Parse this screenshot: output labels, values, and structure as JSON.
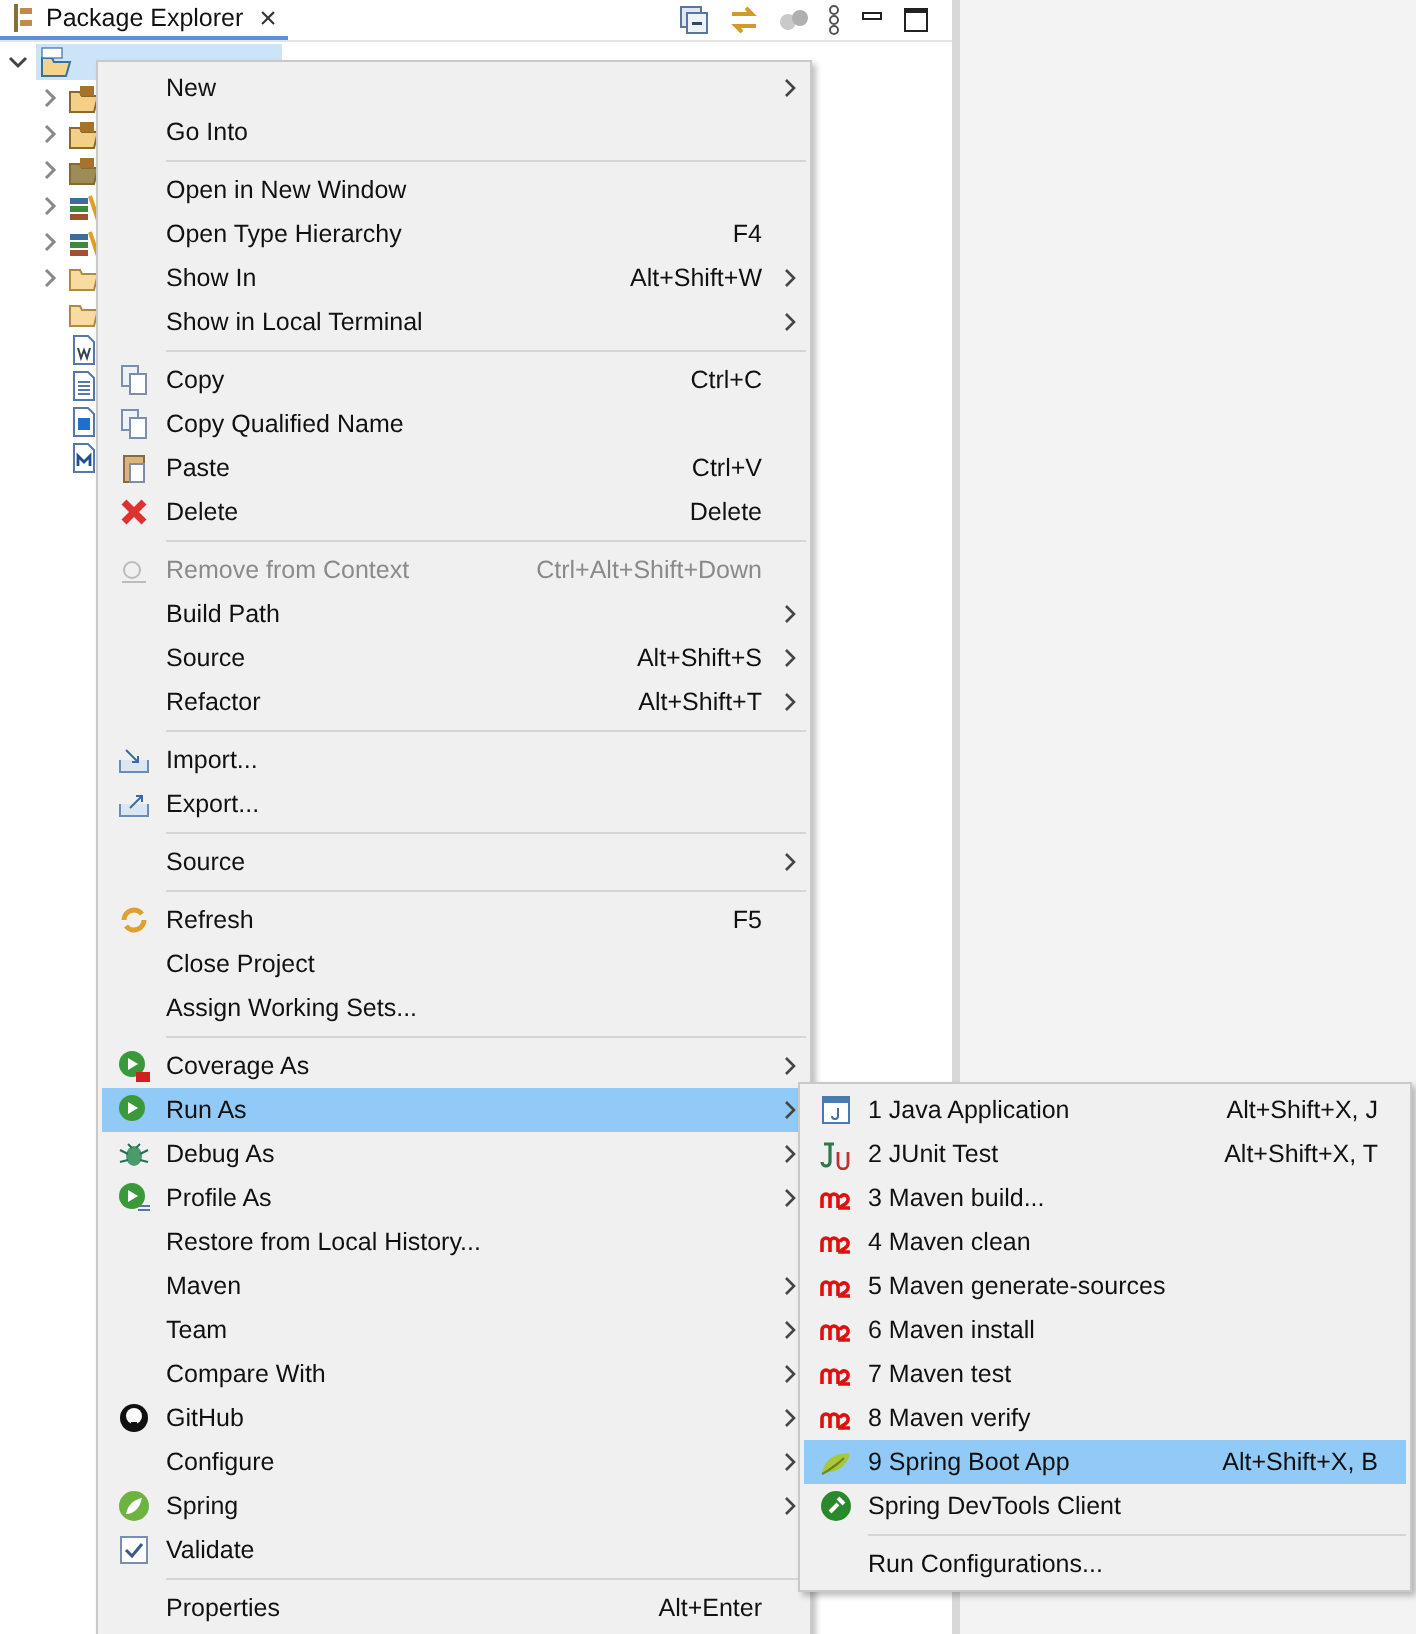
{
  "view": {
    "tab": {
      "label": "Package Explorer",
      "close": "×",
      "selected": true
    }
  },
  "tree": {
    "root": {
      "expanded": true,
      "selected": true,
      "children": [
        {
          "kind": "package",
          "expandable": true
        },
        {
          "kind": "package",
          "expandable": true
        },
        {
          "kind": "package-dark",
          "expandable": true
        },
        {
          "kind": "library",
          "expandable": true
        },
        {
          "kind": "library",
          "expandable": true
        },
        {
          "kind": "folder",
          "expandable": true
        },
        {
          "kind": "folder",
          "expandable": false
        },
        {
          "kind": "word-doc",
          "expandable": false
        },
        {
          "kind": "text-doc",
          "expandable": false
        },
        {
          "kind": "grid-doc",
          "expandable": false
        },
        {
          "kind": "m-doc",
          "expandable": false
        }
      ]
    }
  },
  "context_menu": {
    "items": [
      {
        "kind": "plain",
        "label": "New",
        "submenu": true,
        "disabled": false,
        "selected": false
      },
      {
        "kind": "plain",
        "label": "Go Into",
        "submenu": false,
        "disabled": false,
        "selected": false
      },
      {
        "kind": "separator"
      },
      {
        "kind": "plain",
        "label": "Open in New Window",
        "submenu": false,
        "disabled": false,
        "selected": false
      },
      {
        "kind": "plain",
        "label": "Open Type Hierarchy",
        "shortcut": "F4",
        "submenu": false,
        "disabled": false,
        "selected": false
      },
      {
        "kind": "plain",
        "label": "Show In",
        "shortcut": "Alt+Shift+W",
        "submenu": true,
        "disabled": false,
        "selected": false
      },
      {
        "kind": "plain",
        "label": "Show in Local Terminal",
        "submenu": true,
        "disabled": false,
        "selected": false
      },
      {
        "kind": "separator"
      },
      {
        "kind": "copy",
        "label": "Copy",
        "shortcut": "Ctrl+C",
        "submenu": false,
        "disabled": false,
        "selected": false
      },
      {
        "kind": "copy-qualified",
        "label": "Copy Qualified Name",
        "submenu": false,
        "disabled": false,
        "selected": false
      },
      {
        "kind": "paste",
        "label": "Paste",
        "shortcut": "Ctrl+V",
        "submenu": false,
        "disabled": false,
        "selected": false
      },
      {
        "kind": "delete",
        "label": "Delete",
        "shortcut": "Delete",
        "submenu": false,
        "disabled": false,
        "selected": false
      },
      {
        "kind": "separator"
      },
      {
        "kind": "remove",
        "label": "Remove from Context",
        "shortcut": "Ctrl+Alt+Shift+Down",
        "submenu": false,
        "disabled": true,
        "selected": false
      },
      {
        "kind": "plain",
        "label": "Build Path",
        "submenu": true,
        "disabled": false,
        "selected": false
      },
      {
        "kind": "plain",
        "label": "Source",
        "shortcut": "Alt+Shift+S",
        "submenu": true,
        "disabled": false,
        "selected": false
      },
      {
        "kind": "plain",
        "label": "Refactor",
        "shortcut": "Alt+Shift+T",
        "submenu": true,
        "disabled": false,
        "selected": false
      },
      {
        "kind": "separator"
      },
      {
        "kind": "import",
        "label": "Import...",
        "submenu": false,
        "disabled": false,
        "selected": false
      },
      {
        "kind": "export",
        "label": "Export...",
        "submenu": false,
        "disabled": false,
        "selected": false
      },
      {
        "kind": "separator"
      },
      {
        "kind": "plain",
        "label": "Source",
        "submenu": true,
        "disabled": false,
        "selected": false
      },
      {
        "kind": "separator"
      },
      {
        "kind": "refresh",
        "label": "Refresh",
        "shortcut": "F5",
        "submenu": false,
        "disabled": false,
        "selected": false
      },
      {
        "kind": "plain",
        "label": "Close Project",
        "submenu": false,
        "disabled": false,
        "selected": false
      },
      {
        "kind": "plain",
        "label": "Assign Working Sets...",
        "submenu": false,
        "disabled": false,
        "selected": false
      },
      {
        "kind": "separator"
      },
      {
        "kind": "coverage",
        "label": "Coverage As",
        "submenu": true,
        "disabled": false,
        "selected": false
      },
      {
        "kind": "run",
        "label": "Run As",
        "submenu": true,
        "disabled": false,
        "selected": true
      },
      {
        "kind": "debug",
        "label": "Debug As",
        "submenu": true,
        "disabled": false,
        "selected": false
      },
      {
        "kind": "profile",
        "label": "Profile As",
        "submenu": true,
        "disabled": false,
        "selected": false
      },
      {
        "kind": "plain",
        "label": "Restore from Local History...",
        "submenu": false,
        "disabled": false,
        "selected": false
      },
      {
        "kind": "plain",
        "label": "Maven",
        "submenu": true,
        "disabled": false,
        "selected": false
      },
      {
        "kind": "plain",
        "label": "Team",
        "submenu": true,
        "disabled": false,
        "selected": false
      },
      {
        "kind": "plain",
        "label": "Compare With",
        "submenu": true,
        "disabled": false,
        "selected": false
      },
      {
        "kind": "github",
        "label": "GitHub",
        "submenu": true,
        "disabled": false,
        "selected": false
      },
      {
        "kind": "plain",
        "label": "Configure",
        "submenu": true,
        "disabled": false,
        "selected": false
      },
      {
        "kind": "spring",
        "label": "Spring",
        "submenu": true,
        "disabled": false,
        "selected": false
      },
      {
        "kind": "validate",
        "label": "Validate",
        "submenu": false,
        "disabled": false,
        "selected": false
      },
      {
        "kind": "separator"
      },
      {
        "kind": "plain",
        "label": "Properties",
        "shortcut": "Alt+Enter",
        "submenu": false,
        "disabled": false,
        "selected": false
      }
    ]
  },
  "run_as_submenu": {
    "items": [
      {
        "kind": "java-app",
        "label": "1 Java Application",
        "shortcut": "Alt+Shift+X, J",
        "selected": false
      },
      {
        "kind": "junit",
        "label": "2 JUnit Test",
        "shortcut": "Alt+Shift+X, T",
        "selected": false
      },
      {
        "kind": "maven",
        "label": "3 Maven build...",
        "selected": false
      },
      {
        "kind": "maven",
        "label": "4 Maven clean",
        "selected": false
      },
      {
        "kind": "maven",
        "label": "5 Maven generate-sources",
        "selected": false
      },
      {
        "kind": "maven",
        "label": "6 Maven install",
        "selected": false
      },
      {
        "kind": "maven",
        "label": "7 Maven test",
        "selected": false
      },
      {
        "kind": "maven",
        "label": "8 Maven verify",
        "selected": false
      },
      {
        "kind": "spring-boot",
        "label": "9 Spring Boot App",
        "shortcut": "Alt+Shift+X, B",
        "selected": true
      },
      {
        "kind": "devtools",
        "label": "Spring DevTools Client",
        "selected": false
      },
      {
        "kind": "separator"
      },
      {
        "kind": "plain",
        "label": "Run Configurations...",
        "selected": false
      }
    ]
  }
}
